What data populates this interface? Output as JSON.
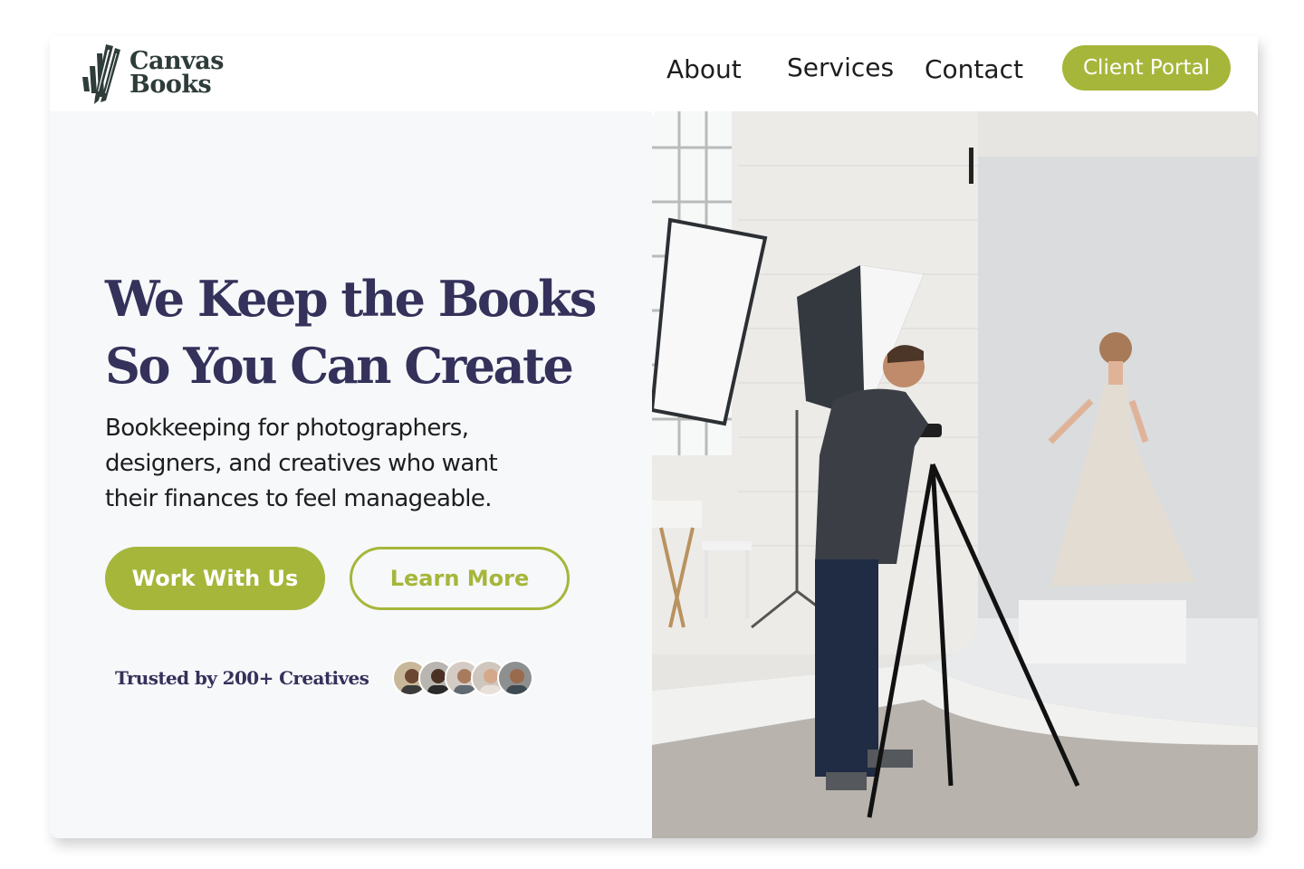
{
  "brand": {
    "name_line1": "Canvas",
    "name_line2": "Books",
    "logo_icon": "pencil-logo-icon",
    "color_dark": "#2e3c3a"
  },
  "nav": {
    "links": [
      "About",
      "Services",
      "Contact"
    ],
    "cta": "Client Portal"
  },
  "hero": {
    "headline_line1": "We Keep the Books",
    "headline_line2": "So You Can Create",
    "subcopy_line1": "Bookkeeping for photographers,",
    "subcopy_line2": "designers, and creatives who want",
    "subcopy_line3": "their finances to feel manageable.",
    "primary_button": "Work With Us",
    "secondary_button": "Learn More",
    "trusted_text": "Trusted by 200+ Creatives",
    "avatar_count": 5,
    "image_icon": "photo-studio-image"
  },
  "colors": {
    "accent": "#a6b63a",
    "heading": "#34315a",
    "hero_bg": "#f6f8fa"
  }
}
